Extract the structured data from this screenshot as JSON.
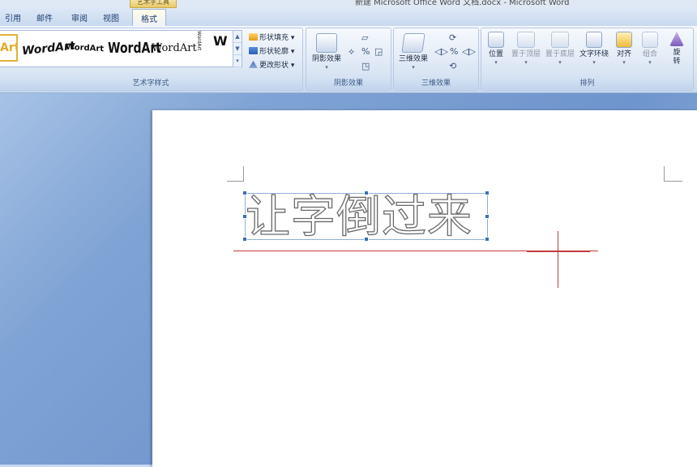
{
  "window": {
    "title": "新建 Microsoft Office Word 文档.docx - Microsoft Word",
    "context_tab": "艺术字工具"
  },
  "tabs": [
    {
      "label": "引用",
      "active": false
    },
    {
      "label": "邮件",
      "active": false
    },
    {
      "label": "审阅",
      "active": false
    },
    {
      "label": "视图",
      "active": false
    },
    {
      "label": "格式",
      "active": true
    }
  ],
  "ribbon": {
    "wordart_styles": {
      "label": "艺术字样式",
      "gallery": [
        "Art",
        "WordArt",
        "WordArt",
        "WordArt",
        "WordArt",
        "WordArt",
        "W"
      ],
      "shape_fill": "形状填充",
      "shape_outline": "形状轮廓",
      "change_shape": "更改形状"
    },
    "shadow_effects": {
      "label": "阴影效果",
      "button": "阴影效果"
    },
    "three_d_effects": {
      "label": "三维效果",
      "button": "三维效果"
    },
    "arrange": {
      "label": "排列",
      "position": "位置",
      "bring_to_front": "置于顶层",
      "send_to_back": "置于底层",
      "text_wrapping": "文字环绕",
      "align": "对齐",
      "group": "组合",
      "rotate_line1": "旋",
      "rotate_line2": "转"
    }
  },
  "document": {
    "wordart_text": "让字倒过来"
  },
  "colors": {
    "accent": "#3a6fb5",
    "guide_line": "#c23a3a",
    "context_tab": "#e7c967"
  }
}
